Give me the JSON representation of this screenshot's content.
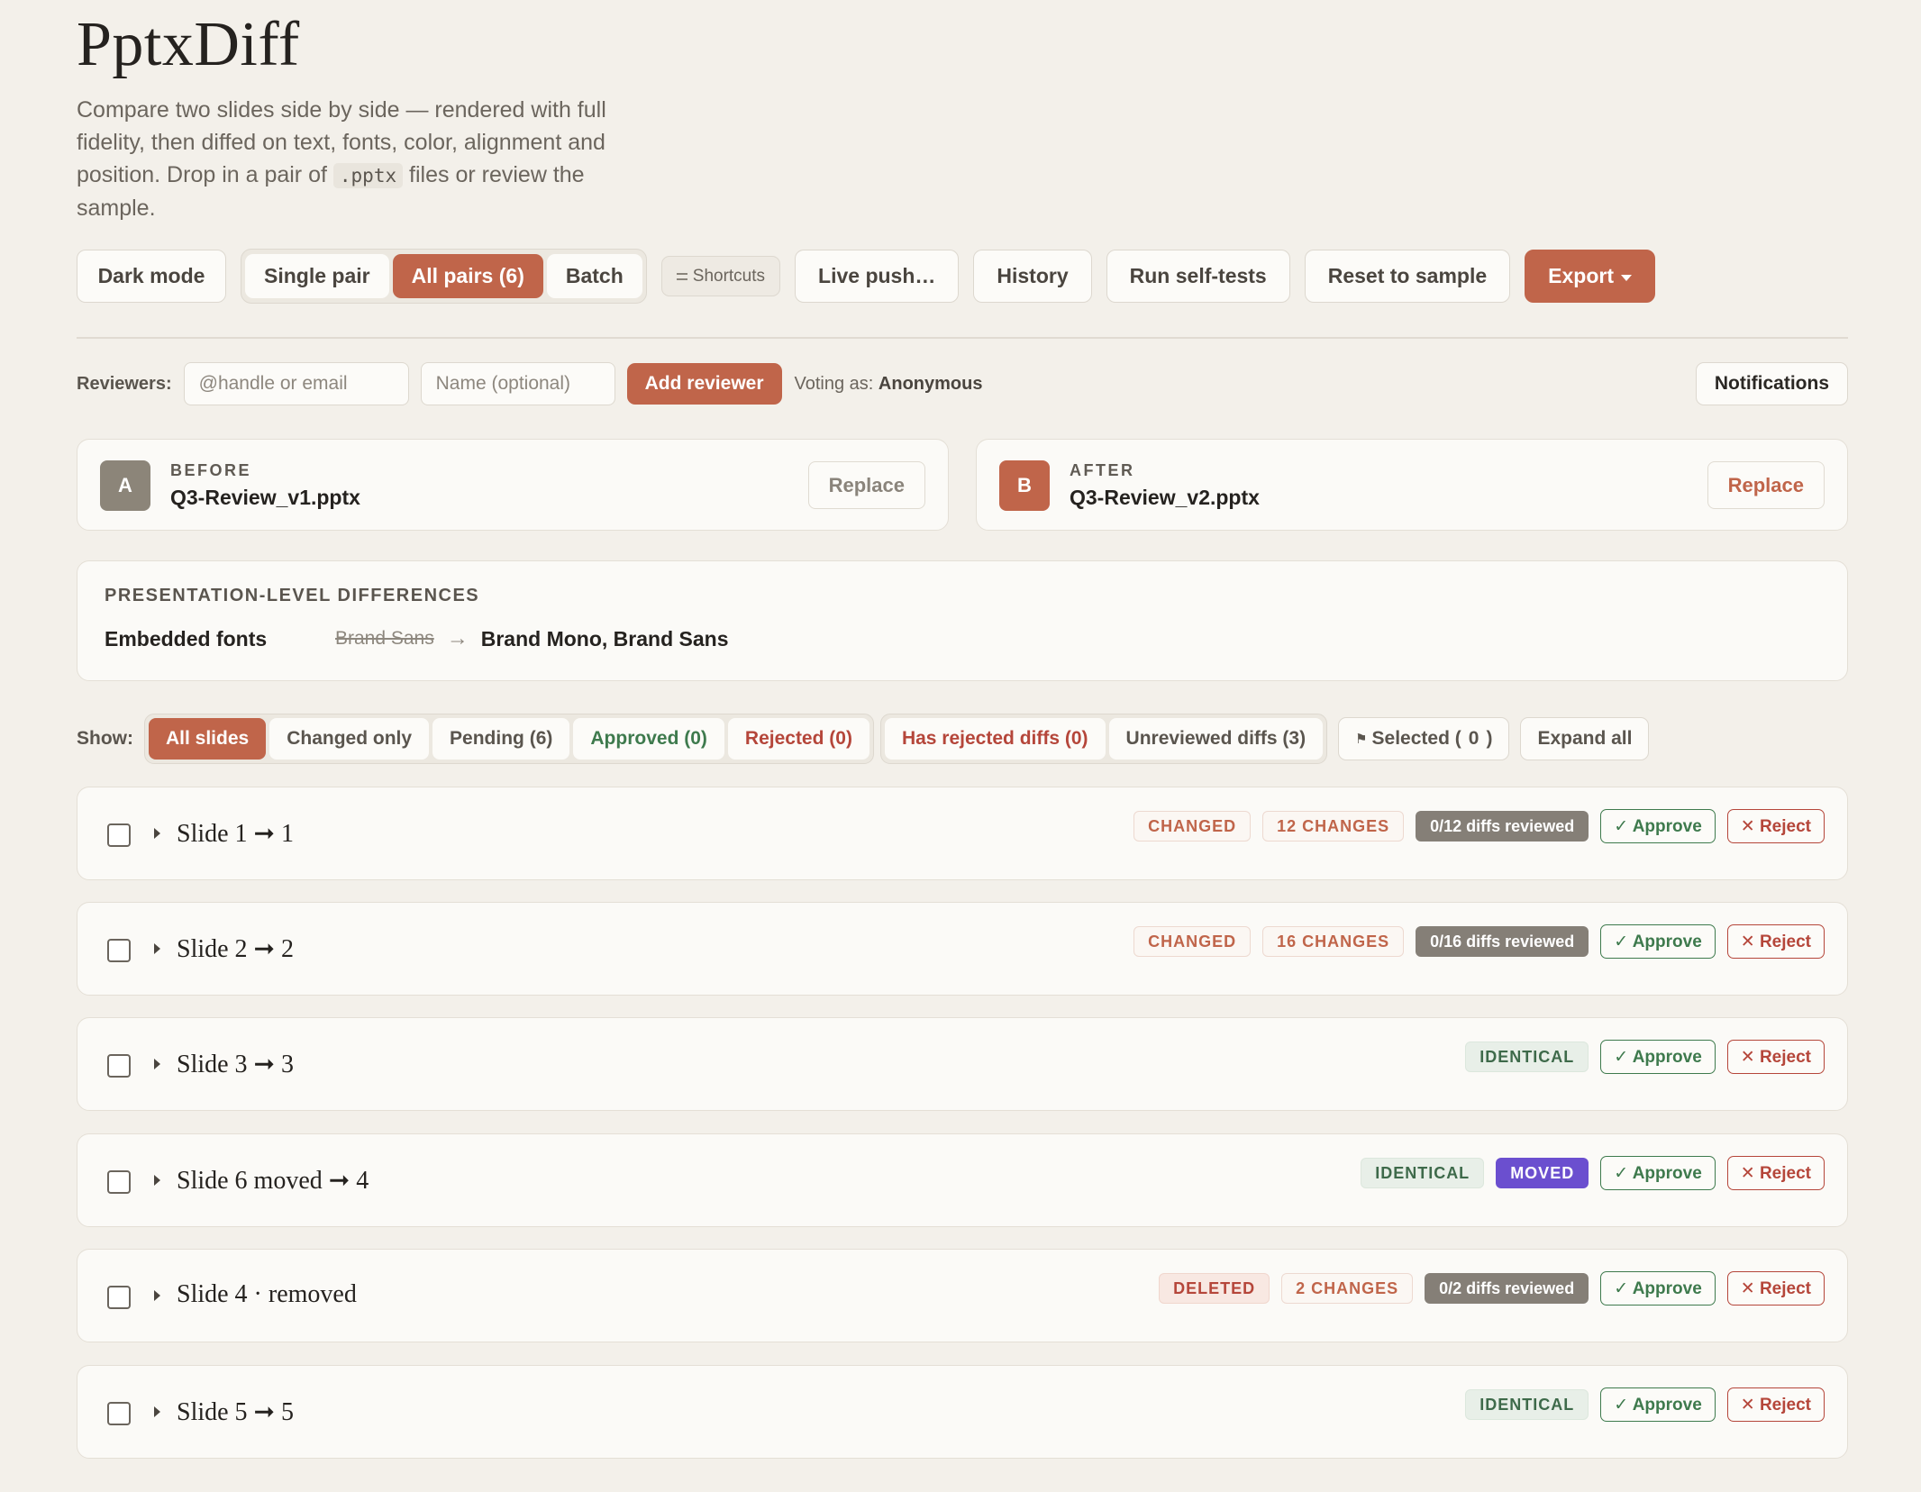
{
  "app": {
    "title": "PptxDiff",
    "subtitle_pre": "Compare two slides side by side — rendered with full fidelity, then diffed on text, fonts, color, alignment and position. Drop in a pair of ",
    "subtitle_code": ".pptx",
    "subtitle_post": " files or review the sample."
  },
  "toolbar": {
    "dark_mode": "Dark mode",
    "modes": [
      "Single pair",
      "All pairs (6)",
      "Batch"
    ],
    "active_mode": "All pairs (6)",
    "shortcuts": "Shortcuts",
    "live_push": "Live push…",
    "history": "History",
    "self_tests": "Run self-tests",
    "reset": "Reset to sample",
    "export": "Export"
  },
  "reviewers": {
    "label": "Reviewers:",
    "handle_placeholder": "@handle or email",
    "name_placeholder": "Name (optional)",
    "add_button": "Add reviewer",
    "voting_label": "Voting as:",
    "voting_name": "Anonymous",
    "notifications": "Notifications"
  },
  "files": {
    "before": {
      "badge": "A",
      "caption": "BEFORE",
      "name": "Q3-Review_v1.pptx",
      "replace": "Replace"
    },
    "after": {
      "badge": "B",
      "caption": "AFTER",
      "name": "Q3-Review_v2.pptx",
      "replace": "Replace"
    }
  },
  "presentation_diffs": {
    "heading": "PRESENTATION-LEVEL DIFFERENCES",
    "key": "Embedded fonts",
    "old": "Brand Sans",
    "arrow": "→",
    "new": "Brand Mono, Brand Sans"
  },
  "filters": {
    "label": "Show:",
    "group1": [
      "All slides",
      "Changed only",
      "Pending (6)",
      "Approved (0)",
      "Rejected (0)"
    ],
    "group2": [
      "Has rejected diffs (0)",
      "Unreviewed diffs (3)"
    ],
    "selected_label": "Selected (",
    "selected_count": "0",
    "selected_close": ")",
    "expand_all": "Expand all"
  },
  "actions": {
    "approve": "✓ Approve",
    "reject": "✕ Reject"
  },
  "slides": [
    {
      "title": "Slide 1 ➞ 1",
      "tags": [
        "CHANGED",
        "12 CHANGES"
      ],
      "review": "0/12 diffs reviewed"
    },
    {
      "title": "Slide 2 ➞ 2",
      "tags": [
        "CHANGED",
        "16 CHANGES"
      ],
      "review": "0/16 diffs reviewed"
    },
    {
      "title": "Slide 3 ➞ 3",
      "tags": [
        "IDENTICAL"
      ]
    },
    {
      "title": "Slide 6 moved ➞ 4",
      "tags": [
        "IDENTICAL",
        "MOVED"
      ]
    },
    {
      "title": "Slide 4 · removed",
      "tags": [
        "DELETED",
        "2 CHANGES"
      ],
      "review": "0/2 diffs reviewed"
    },
    {
      "title": "Slide 5 ➞ 5",
      "tags": [
        "IDENTICAL"
      ]
    }
  ],
  "colors": {
    "accent": "#c0654a",
    "background": "#f3f0ea",
    "approve": "#3e7a4d",
    "reject": "#b5463a",
    "moved": "#6b4fcf",
    "before_badge": "#8c8579"
  }
}
